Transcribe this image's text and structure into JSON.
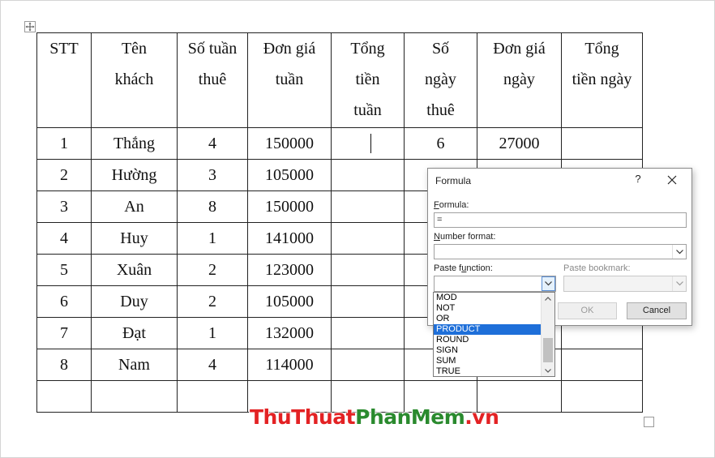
{
  "table": {
    "headers": [
      [
        "STT"
      ],
      [
        "Tên",
        "khách"
      ],
      [
        "Số tuần",
        "thuê"
      ],
      [
        "Đơn giá",
        "tuần"
      ],
      [
        "Tổng",
        "tiền",
        "tuần"
      ],
      [
        "Số",
        "ngày",
        "thuê"
      ],
      [
        "Đơn giá",
        "ngày"
      ],
      [
        "Tổng",
        "tiền ngày"
      ]
    ],
    "rows": [
      [
        "1",
        "Thắng",
        "4",
        "150000",
        "",
        "6",
        "27000",
        ""
      ],
      [
        "2",
        "Hường",
        "3",
        "105000",
        "",
        "",
        "",
        ""
      ],
      [
        "3",
        "An",
        "8",
        "150000",
        "",
        "",
        "",
        ""
      ],
      [
        "4",
        "Huy",
        "1",
        "141000",
        "",
        "",
        "",
        ""
      ],
      [
        "5",
        "Xuân",
        "2",
        "123000",
        "",
        "",
        "",
        ""
      ],
      [
        "6",
        "Duy",
        "2",
        "105000",
        "",
        "",
        "",
        ""
      ],
      [
        "7",
        "Đạt",
        "1",
        "132000",
        "",
        "",
        "",
        ""
      ],
      [
        "8",
        "Nam",
        "4",
        "114000",
        "",
        "",
        "",
        ""
      ],
      [
        "",
        "",
        "",
        "",
        "",
        "",
        "",
        ""
      ]
    ]
  },
  "dialog": {
    "title": "Formula",
    "help": "?",
    "formula_label_key": "F",
    "formula_label_rest": "ormula:",
    "formula_value": "=",
    "number_format_label_key": "N",
    "number_format_label_rest": "umber format:",
    "paste_function_label_pre": "Paste f",
    "paste_function_label_key": "u",
    "paste_function_label_rest": "nction:",
    "paste_bookmark_label": "Paste bookmark:",
    "function_list": [
      "MOD",
      "NOT",
      "OR",
      "PRODUCT",
      "ROUND",
      "SIGN",
      "SUM",
      "TRUE"
    ],
    "selected_function": "PRODUCT",
    "ok_label": "OK",
    "cancel_label": "Cancel"
  },
  "watermark": {
    "part1": "ThuThuat",
    "part2": "PhanMem",
    "part3": ".vn"
  },
  "colors": {
    "selection": "#1e6fd9",
    "watermark_red": "#e32224",
    "watermark_green": "#2a8a2e"
  }
}
